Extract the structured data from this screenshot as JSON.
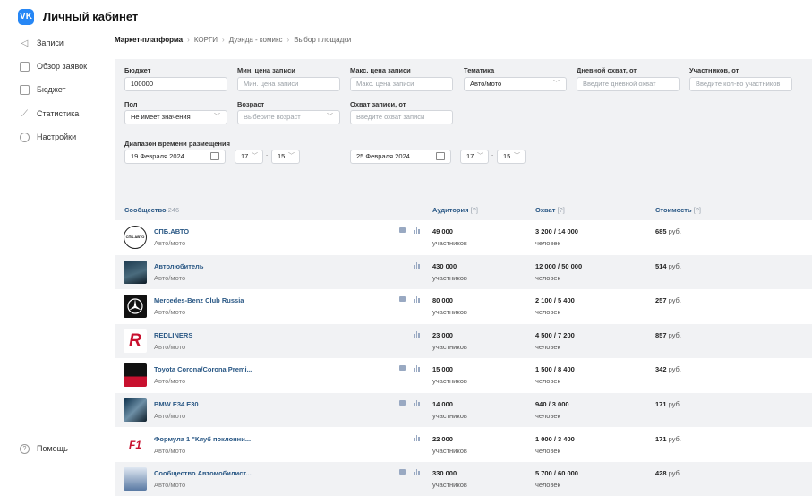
{
  "app": {
    "logo": "VK",
    "title": "Личный кабинет",
    "caret": "⌄"
  },
  "sidebar": {
    "items": [
      {
        "label": "Записи",
        "icon": "megaphone-icon"
      },
      {
        "label": "Обзор заявок",
        "icon": "list-icon"
      },
      {
        "label": "Бюджет",
        "icon": "wallet-icon"
      },
      {
        "label": "Статистика",
        "icon": "chart-icon"
      },
      {
        "label": "Настройки",
        "icon": "gear-icon"
      }
    ],
    "help": "Помощь"
  },
  "breadcrumb": {
    "items": [
      "Маркет-платформа",
      "КОРГИ",
      "Дуэнда - комикс",
      "Выбор площадки"
    ],
    "separator": "›"
  },
  "filters": {
    "budget": {
      "label": "Бюджет",
      "value": "100000"
    },
    "min_price": {
      "label": "Мин. цена записи",
      "placeholder": "Мин. цена записи"
    },
    "max_price": {
      "label": "Макс. цена записи",
      "placeholder": "Макс. цена записи"
    },
    "topic": {
      "label": "Тематика",
      "value": "Авто/мото"
    },
    "daily_reach": {
      "label": "Дневной охват, от",
      "placeholder": "Введите дневной охват"
    },
    "members": {
      "label": "Участников, от",
      "placeholder": "Введите кол-во участников"
    },
    "gender": {
      "label": "Пол",
      "value": "Не имеет значения"
    },
    "age": {
      "label": "Возраст",
      "placeholder": "Выберите возраст"
    },
    "reach": {
      "label": "Охват записи, от",
      "placeholder": "Введите охват записи"
    },
    "range": {
      "label": "Диапазон времени размещения",
      "from_date": "19 Февраля 2024",
      "from_hour": "17",
      "from_min": "15",
      "to_date": "25 Февраля 2024",
      "to_hour": "17",
      "to_min": "15",
      "colon": ":"
    }
  },
  "table": {
    "headers": {
      "community": "Сообщество",
      "community_count": "246",
      "audience": "Аудитория",
      "reach": "Охват",
      "price": "Стоимость",
      "help_mark": "[?]"
    },
    "members_word": "участников",
    "people_word": "человек",
    "currency": "руб.",
    "rows": [
      {
        "name": "СПБ.АВТО",
        "category": "Авто/мото",
        "audience": "49 000",
        "reach": "3 200 / 14 000",
        "price": "685",
        "has_msg": true,
        "avatar_icon": "spb-auto-logo-icon",
        "avatar_text": "СПБ.АВТО"
      },
      {
        "name": "Автолюбитель",
        "category": "Авто/мото",
        "audience": "430 000",
        "reach": "12 000 / 50 000",
        "price": "514",
        "has_msg": false,
        "avatar_icon": "car-photo-icon",
        "avatar_text": ""
      },
      {
        "name": "Mercedes-Benz Club Russia",
        "category": "Авто/мото",
        "audience": "80 000",
        "reach": "2 100 / 5 400",
        "price": "257",
        "has_msg": true,
        "avatar_icon": "mercedes-logo-icon",
        "avatar_text": ""
      },
      {
        "name": "REDLINERS",
        "category": "Авто/мото",
        "audience": "23 000",
        "reach": "4 500 / 7 200",
        "price": "857",
        "has_msg": false,
        "avatar_icon": "redliners-logo-icon",
        "avatar_text": "R"
      },
      {
        "name": "Toyota Corona/Corona Premi...",
        "category": "Авто/мото",
        "audience": "15 000",
        "reach": "1 500 / 8 400",
        "price": "342",
        "has_msg": true,
        "avatar_icon": "toyota-logo-icon",
        "avatar_text": ""
      },
      {
        "name": "BMW E34 E30",
        "category": "Авто/мото",
        "audience": "14 000",
        "reach": "940 / 3 000",
        "price": "171",
        "has_msg": true,
        "avatar_icon": "bmw-photo-icon",
        "avatar_text": ""
      },
      {
        "name": "Формула 1 \"Клуб поклонни...",
        "category": "Авто/мото",
        "audience": "22 000",
        "reach": "1 000 / 3 400",
        "price": "171",
        "has_msg": false,
        "avatar_icon": "f1-logo-icon",
        "avatar_text": "F1"
      },
      {
        "name": "Сообщество Автомобилист...",
        "category": "Авто/мото",
        "audience": "330 000",
        "reach": "5 700 / 60 000",
        "price": "428",
        "has_msg": true,
        "avatar_icon": "car-club-logo-icon",
        "avatar_text": ""
      }
    ]
  },
  "colors": {
    "accent": "#2787f5",
    "link": "#2a5885",
    "panel": "#f1f2f4"
  }
}
